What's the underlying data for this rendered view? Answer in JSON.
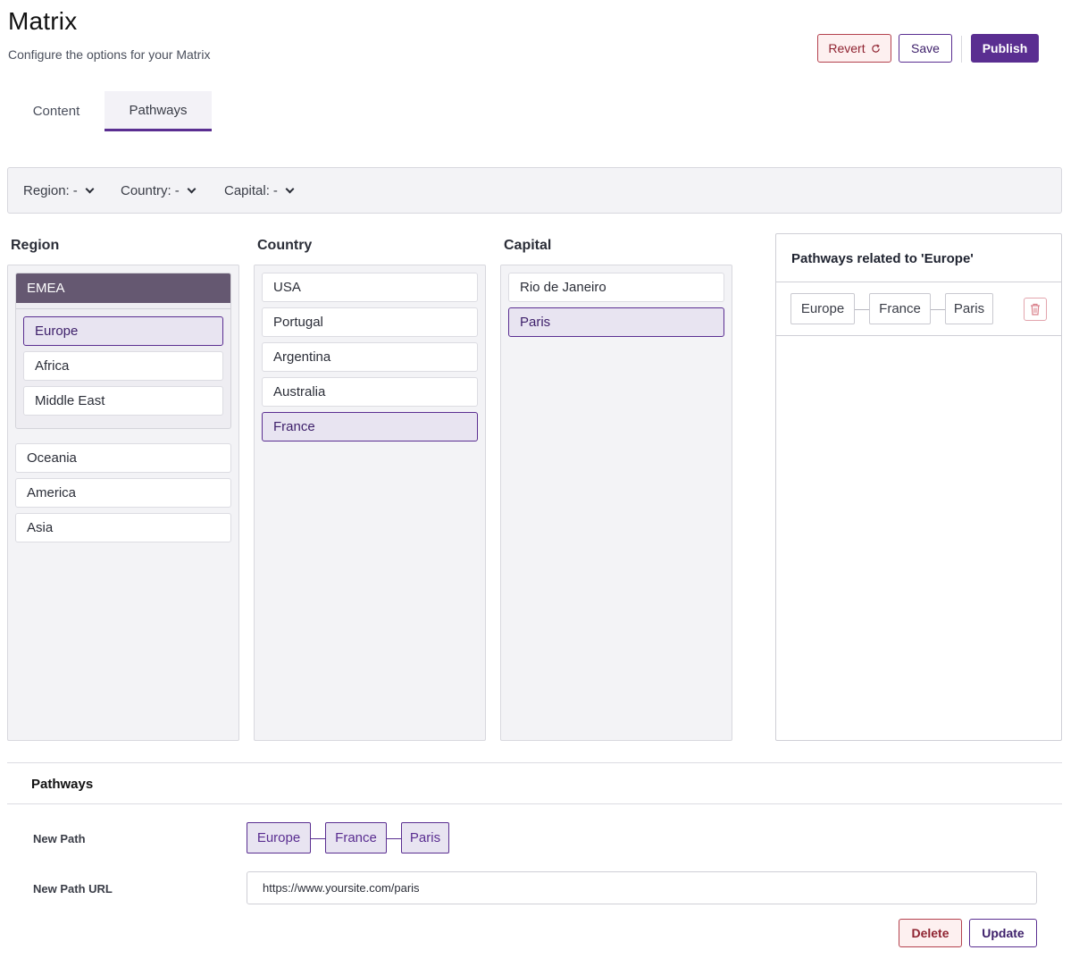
{
  "header": {
    "title": "Matrix",
    "subtitle": "Configure the options for your Matrix",
    "revert_label": "Revert",
    "save_label": "Save",
    "publish_label": "Publish"
  },
  "tabs": [
    {
      "label": "Content",
      "active": false
    },
    {
      "label": "Pathways",
      "active": true
    }
  ],
  "filters": [
    {
      "label": "Region:",
      "value": "-"
    },
    {
      "label": "Country:",
      "value": "-"
    },
    {
      "label": "Capital:",
      "value": "-"
    }
  ],
  "columns": {
    "region": {
      "title": "Region",
      "group": {
        "label": "EMEA",
        "items": [
          {
            "label": "Europe",
            "selected": true
          },
          {
            "label": "Africa",
            "selected": false
          },
          {
            "label": "Middle East",
            "selected": false
          }
        ]
      },
      "items": [
        {
          "label": "Oceania",
          "selected": false
        },
        {
          "label": "America",
          "selected": false
        },
        {
          "label": "Asia",
          "selected": false
        }
      ]
    },
    "country": {
      "title": "Country",
      "items": [
        {
          "label": "USA",
          "selected": false
        },
        {
          "label": "Portugal",
          "selected": false
        },
        {
          "label": "Argentina",
          "selected": false
        },
        {
          "label": "Australia",
          "selected": false
        },
        {
          "label": "France",
          "selected": true
        }
      ]
    },
    "capital": {
      "title": "Capital",
      "items": [
        {
          "label": "Rio de Janeiro",
          "selected": false
        },
        {
          "label": "Paris",
          "selected": true
        }
      ]
    }
  },
  "related": {
    "title": "Pathways related to 'Europe'",
    "path": [
      "Europe",
      "France",
      "Paris"
    ]
  },
  "pathways_section": {
    "title": "Pathways",
    "new_path_label": "New Path",
    "new_path": [
      "Europe",
      "France",
      "Paris"
    ],
    "new_path_url_label": "New Path URL",
    "new_path_url": "https://www.yoursite.com/paris",
    "delete_label": "Delete",
    "update_label": "Update"
  },
  "colors": {
    "accent": "#5a2e91",
    "group_header": "#655871",
    "selected_bg": "#e8e4f1",
    "danger": "#b4424e"
  }
}
